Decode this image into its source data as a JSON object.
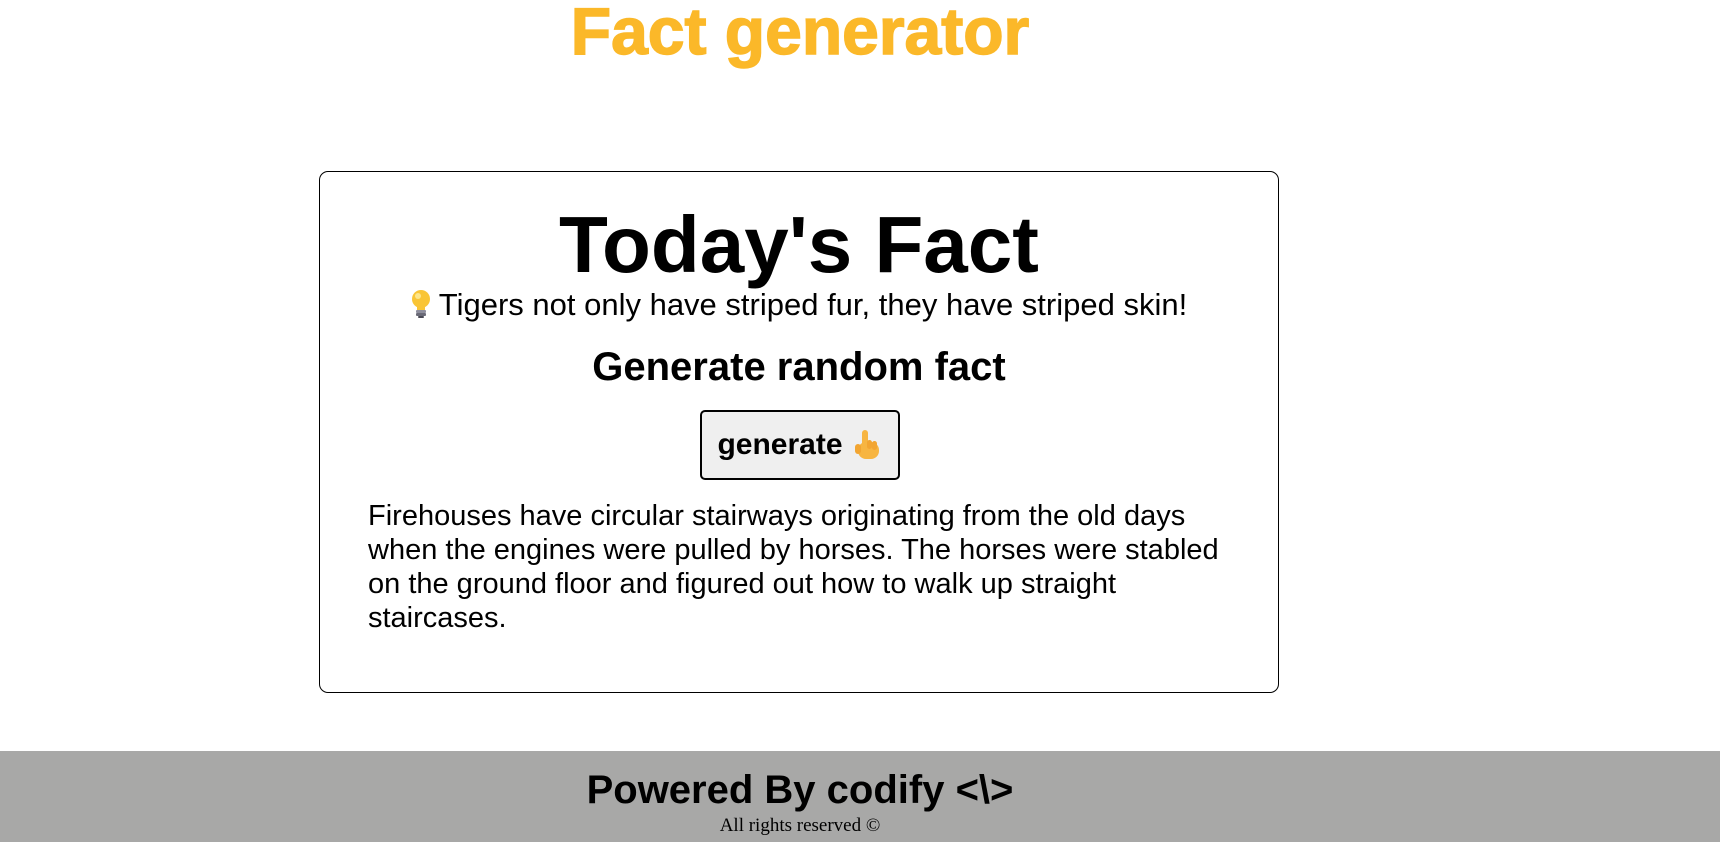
{
  "header": {
    "site_title": "Fact generator",
    "title_color": "#fbb829"
  },
  "card": {
    "title": "Today's Fact",
    "featured_fact_icon": "lightbulb-icon",
    "featured_fact": "Tigers not only have striped fur, they have striped skin!",
    "generate_heading": "Generate random fact",
    "generate_button_label": "generate",
    "generate_button_icon": "pointing-hand-icon",
    "generated_fact": "Firehouses have circular stairways originating from the old days when the engines were pulled by horses. The horses were stabled on the ground floor and figured out how to walk up straight staircases."
  },
  "footer": {
    "powered_by": "Powered By codify <\\>",
    "rights": "All rights reserved ©",
    "background_color": "#a8a8a7"
  }
}
